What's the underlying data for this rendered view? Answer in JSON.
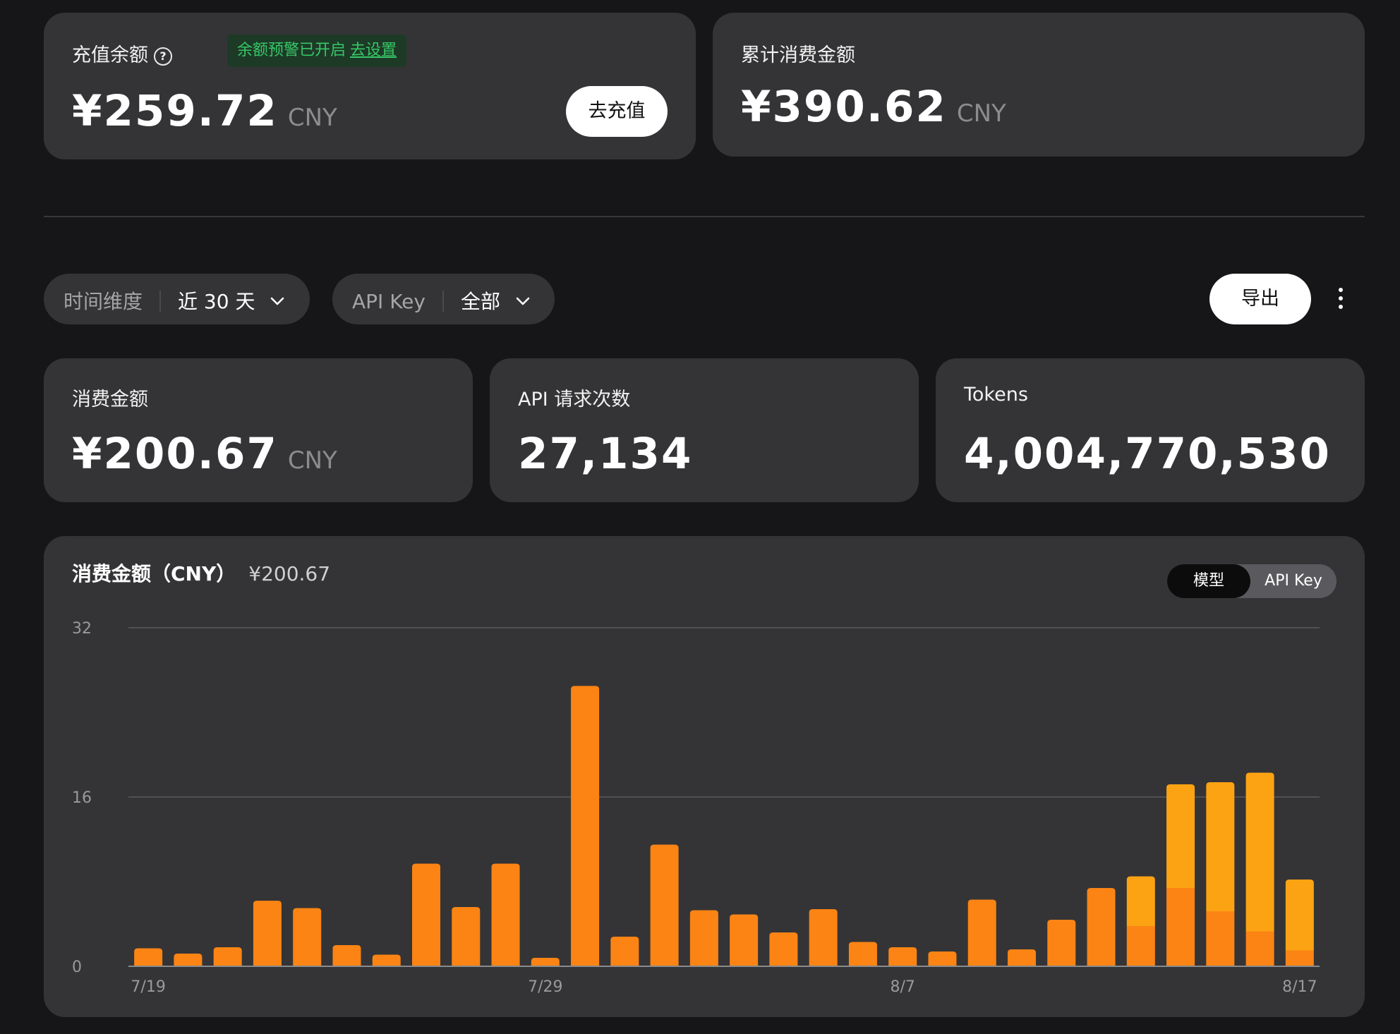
{
  "balance_card": {
    "title": "充值余额",
    "warning_text": "余额预警已开启",
    "warning_link": "去设置",
    "amount": "¥259.72",
    "currency": "CNY",
    "recharge_button": "去充值"
  },
  "total_card": {
    "title": "累计消费金额",
    "amount": "¥390.62",
    "currency": "CNY"
  },
  "filters": {
    "time": {
      "label": "时间维度",
      "value": "近 30 天"
    },
    "apikey": {
      "label": "API Key",
      "value": "全部"
    },
    "export_button": "导出"
  },
  "stats": [
    {
      "title": "消费金额",
      "value": "¥200.67",
      "currency": "CNY"
    },
    {
      "title": "API 请求次数",
      "value": "27,134"
    },
    {
      "title": "Tokens",
      "value": "4,004,770,530"
    }
  ],
  "chart_panel": {
    "title": "消费金额（CNY）",
    "total": "¥200.67",
    "toggle_active": "模型",
    "toggle_inactive": "API Key"
  },
  "colors": {
    "series_a": "#fb8414",
    "series_b": "#fca313",
    "card_bg": "#343436",
    "page_bg": "#161618",
    "warning_green": "#36c766"
  },
  "chart_data": {
    "type": "bar",
    "stacked": true,
    "categories": [
      "7/19",
      "7/20",
      "7/21",
      "7/22",
      "7/23",
      "7/24",
      "7/25",
      "7/26",
      "7/27",
      "7/28",
      "7/29",
      "7/30",
      "7/31",
      "8/1",
      "8/2",
      "8/3",
      "8/4",
      "8/5",
      "8/6",
      "8/7",
      "8/8",
      "8/9",
      "8/10",
      "8/11",
      "8/12",
      "8/13",
      "8/14",
      "8/15",
      "8/16",
      "8/17"
    ],
    "x_tick_labels": [
      "7/19",
      "7/29",
      "8/7",
      "8/17"
    ],
    "series": [
      {
        "values": [
          1.7,
          1.2,
          1.8,
          6.2,
          5.5,
          2.0,
          1.1,
          9.7,
          5.6,
          9.7,
          0.8,
          26.5,
          2.8,
          11.5,
          5.3,
          4.9,
          3.2,
          5.4,
          2.3,
          1.8,
          1.4,
          6.3,
          1.6,
          4.4,
          7.4,
          3.8,
          7.4,
          5.2,
          3.3,
          1.5
        ]
      },
      {
        "values": [
          0,
          0,
          0,
          0,
          0,
          0,
          0,
          0,
          0,
          0,
          0,
          0,
          0,
          0,
          0,
          0,
          0,
          0,
          0,
          0,
          0,
          0,
          0,
          0,
          0,
          4.7,
          9.8,
          12.2,
          15.0,
          6.7
        ]
      }
    ],
    "ylim": [
      0,
      32
    ],
    "yticks": [
      0,
      16,
      32
    ],
    "grid": true
  }
}
